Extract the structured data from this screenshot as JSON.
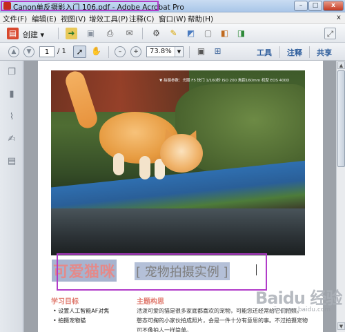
{
  "window": {
    "title": "Canon单反摄影入门 106.pdf - Adobe Acrobat Pro",
    "min_symbol": "–",
    "max_symbol": "□",
    "close_symbol": "x"
  },
  "menu": {
    "items": [
      "文件(F)",
      "编辑(E)",
      "视图(V)",
      "增效工具(P)",
      "注释(C)",
      "窗口(W)",
      "帮助(H)"
    ],
    "close_symbol": "x"
  },
  "toolbar": {
    "create_label": "创建 ▾"
  },
  "nav": {
    "page_current": "1",
    "page_total": "/ 1",
    "zoom": "73.8%",
    "zoom_arrow": "▼",
    "right_tabs": [
      "工具",
      "注释",
      "共享"
    ]
  },
  "document": {
    "photo_caption": "▼ 拍摄参数：光圈 F5 快门 1/160秒 ISO 200 焦距160mm 机型 EOS 400D",
    "heading_main": "可爱猫咪",
    "heading_sub": "[ 宠物拍摄实例 ]",
    "left_section_title": "学习目标",
    "left_bullets": [
      "• 设置人工智能AF对焦",
      "• 拍摄宠物猫"
    ],
    "right_section_title": "主题构思",
    "right_body": [
      "    活泼可爱的猫是很多家庭都喜欢的宠物，可能您还经常给它们拍照。",
      "憨态可掬的小家伙拍成照片，会是一件十分有意思的事。不过拍摄宠物",
      "可不像拍人一样简单。"
    ]
  },
  "watermark": {
    "text": "Baidu 经验",
    "sub": "jingyan.baidu.com"
  },
  "colors": {
    "highlight_border": "#b13bc9",
    "heading_pink": "#e48a8a",
    "section_title": "#e07b6f",
    "tab_blue": "#2d5d9c"
  }
}
